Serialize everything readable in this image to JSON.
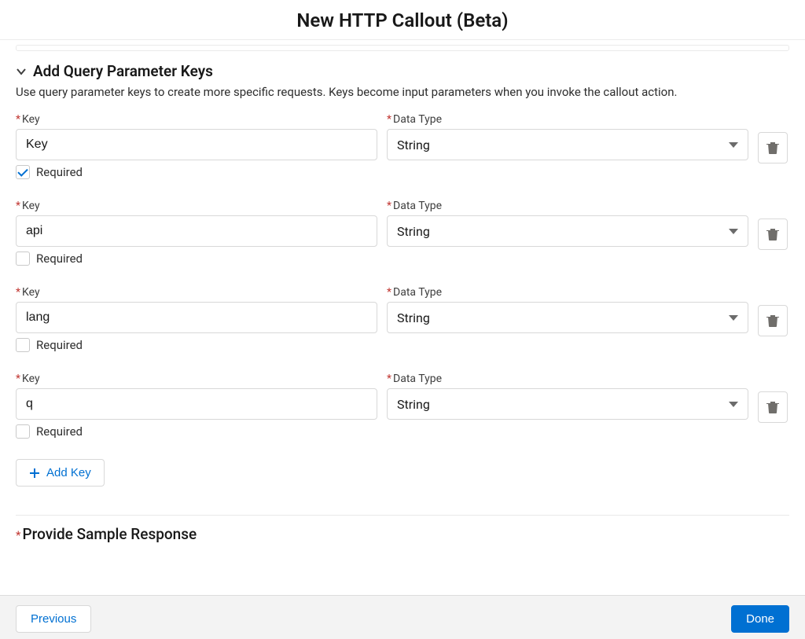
{
  "header": {
    "title": "New HTTP Callout (Beta)"
  },
  "section": {
    "title": "Add Query Parameter Keys",
    "description": "Use query parameter keys to create more specific requests. Keys become input parameters when you invoke the callout action."
  },
  "labels": {
    "key": "Key",
    "dataType": "Data Type",
    "required": "Required",
    "addKey": "Add Key"
  },
  "params": [
    {
      "key": "Key",
      "type": "String",
      "required": true
    },
    {
      "key": "api",
      "type": "String",
      "required": false
    },
    {
      "key": "lang",
      "type": "String",
      "required": false
    },
    {
      "key": "q",
      "type": "String",
      "required": false
    }
  ],
  "sampleSection": {
    "title": "Provide Sample Response"
  },
  "footer": {
    "previous": "Previous",
    "done": "Done"
  }
}
